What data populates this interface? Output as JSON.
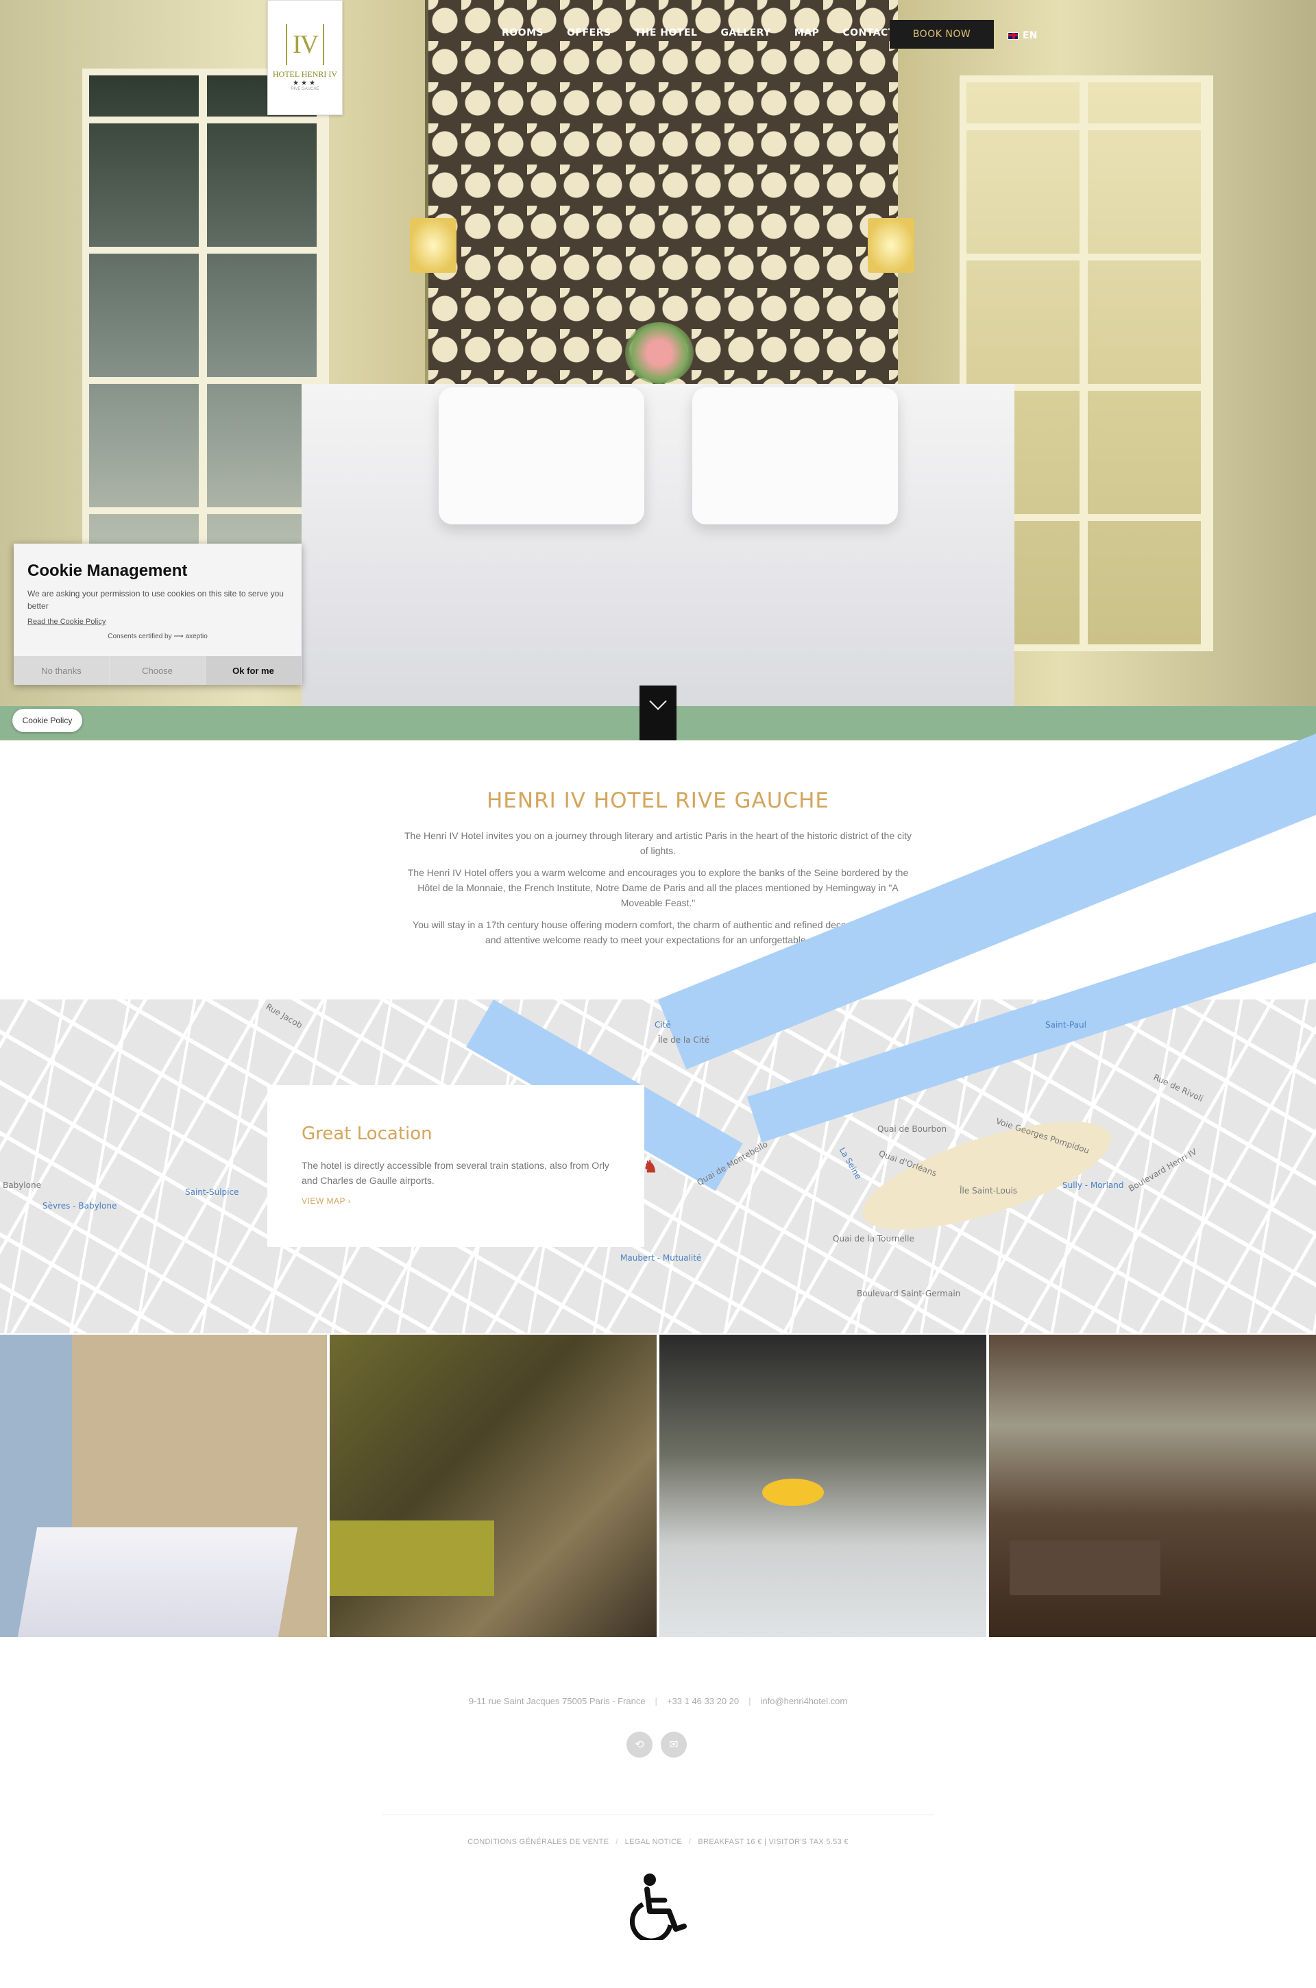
{
  "brand": {
    "logo_mark": "IV",
    "logo_name": "HOTEL HENRI IV",
    "logo_stars": "★★★",
    "logo_sub": "RIVE GAUCHE"
  },
  "nav": {
    "items": [
      "ROOMS",
      "OFFERS",
      "THE HOTEL",
      "GALLERY",
      "MAP",
      "CONTACT"
    ],
    "book_now": "BOOK NOW",
    "language": "EN"
  },
  "cookie": {
    "title": "Cookie Management",
    "text": "We are asking your permission to use cookies on this site to serve you better",
    "read_link": "Read the Cookie Policy",
    "certified": "Consents certified by ⟿ axeptio",
    "btn_no": "No thanks",
    "btn_choose": "Choose",
    "btn_ok": "Ok for me",
    "policy_pill": "Cookie Policy"
  },
  "intro": {
    "title": "HENRI IV HOTEL RIVE GAUCHE",
    "p1": "The Henri IV Hotel invites you on a journey through literary and artistic Paris in the heart of the historic district of the city of lights.",
    "p2": "The Henri IV Hotel offers you a warm welcome and encourages you to explore the banks of the Seine bordered by the Hôtel de la Monnaie, the French Institute, Notre Dame de Paris and all the places mentioned by Hemingway in \"A Moveable Feast.\"",
    "p3": "You will stay in a 17th century house offering modern comfort, the charm of authentic and refined decor with a warm and attentive welcome ready to meet your expectations for an unforgettable stay.."
  },
  "map": {
    "card_title": "Great Location",
    "card_text": "The hotel is directly accessible from several train stations, also from Orly and Charles de Gaulle airports.",
    "view_map": "VIEW MAP ›",
    "labels": {
      "ile_cite": "Île de la Cité",
      "cite": "Cité",
      "saint_louis": "Île Saint-Louis",
      "saint_paul": "Saint-Paul",
      "sully": "Sully - Morland",
      "maubert": "Maubert - Mutualité",
      "sevres": "Sèvres - Babylone",
      "saint_sulpice": "Saint-Sulpice",
      "babylone": "Babylone",
      "bd_saint_germain": "Boulevard Saint-Germain",
      "bd_henri_iv": "Boulevard Henri IV",
      "la_seine": "La Seine",
      "rue_jacob": "Rue Jacob",
      "quai_bourbon": "Quai de Bourbon",
      "quai_orleans": "Quai d'Orléans",
      "quai_tournelle": "Quai de la Tournelle",
      "rue_montebello": "Quai de Montebello",
      "voie_pompidou": "Voie Georges Pompidou",
      "rue_rivoli": "Rue de Rivoli"
    }
  },
  "footer": {
    "address": "9-11 rue Saint Jacques 75005 Paris - France",
    "phone": "+33 1 46 33 20 20",
    "email": "info@henri4hotel.com",
    "links": [
      "CONDITIONS GÉNÉRALES DE VENTE",
      "LEGAL NOTICE",
      "BREAKFAST 16 € | VISITOR'S TAX 5.53 €"
    ]
  },
  "colors": {
    "gold": "#d3a55c",
    "book_button_bg": "#1c1c1c",
    "river": "#abd0f7"
  }
}
